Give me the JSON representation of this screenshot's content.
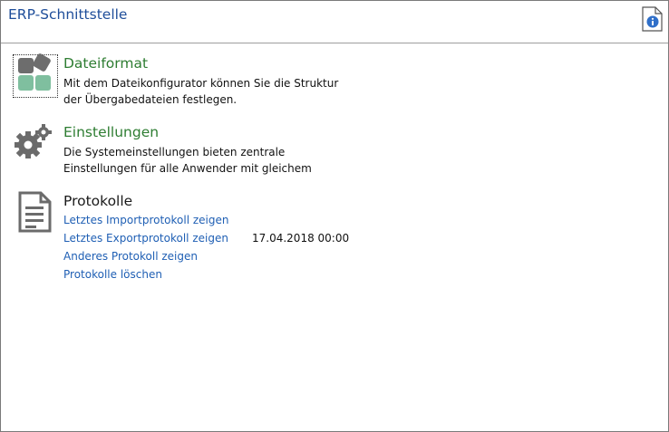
{
  "window": {
    "title": "ERP-Schnittstelle",
    "help_icon": "info-document-icon"
  },
  "sections": {
    "dateiformat": {
      "icon": "tiles-icon",
      "title": "Dateiformat",
      "desc_line1": "Mit dem Dateikonfigurator können Sie die Struktur",
      "desc_line2": "der Übergabedateien festlegen."
    },
    "einstellungen": {
      "icon": "gears-icon",
      "title": "Einstellungen",
      "desc_line1": "Die Systemeinstellungen bieten zentrale",
      "desc_line2": "Einstellungen für alle Anwender mit gleichem"
    },
    "protokolle": {
      "icon": "document-icon",
      "title": "Protokolle",
      "links": {
        "import": "Letztes Importprotokoll zeigen",
        "export": "Letztes Exportprotokoll zeigen",
        "other": "Anderes Protokoll zeigen",
        "delete": "Protokolle löschen"
      },
      "export_timestamp": "17.04.2018 00:00"
    }
  },
  "colors": {
    "title": "#1f4e9a",
    "section_title": "#2e7d32",
    "link": "#1f5fb4"
  }
}
